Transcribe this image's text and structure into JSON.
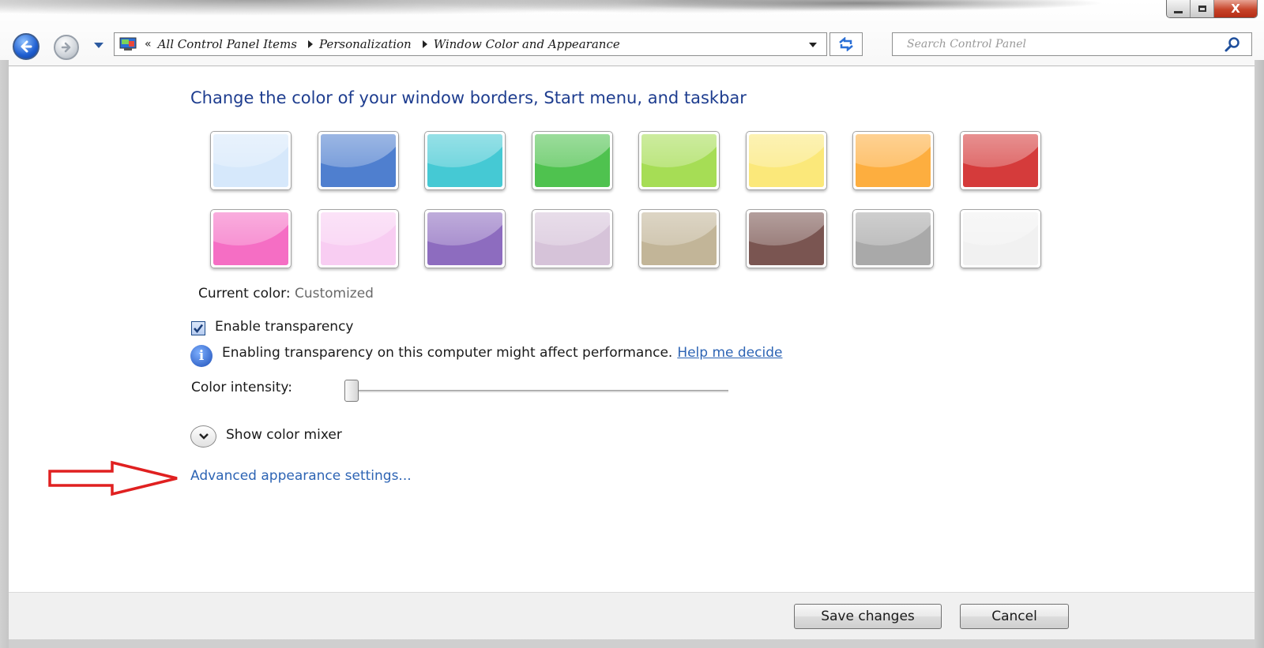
{
  "window": {
    "caption": {
      "minimize": "",
      "maximize": "",
      "close": "X"
    }
  },
  "address_bar": {
    "chevron": "«",
    "items": [
      "All Control Panel Items",
      "Personalization",
      "Window Color and Appearance"
    ]
  },
  "search": {
    "placeholder": "Search Control Panel"
  },
  "main": {
    "heading": "Change the color of your window borders, Start menu, and taskbar",
    "swatches": [
      {
        "color": "#d6e8fb"
      },
      {
        "color": "#4f7fcf"
      },
      {
        "color": "#45c9d4"
      },
      {
        "color": "#4fc24f"
      },
      {
        "color": "#a6dd55"
      },
      {
        "color": "#fbe87a"
      },
      {
        "color": "#fdae3f"
      },
      {
        "color": "#d53b3b"
      },
      {
        "color": "#f56ec4"
      },
      {
        "color": "#f8cdf2"
      },
      {
        "color": "#8d6cbf"
      },
      {
        "color": "#d6c3d9"
      },
      {
        "color": "#c2b598"
      },
      {
        "color": "#7a5551"
      },
      {
        "color": "#a9a9a9"
      },
      {
        "color": "#f1f1f1"
      }
    ],
    "current_color_label": "Current color:",
    "current_color_value": "Customized",
    "transparency_label": "Enable transparency",
    "transparency_checked": true,
    "info_icon": "i",
    "info_text": "Enabling transparency on this computer might affect performance.",
    "info_link": "Help me decide",
    "intensity_label": "Color intensity:",
    "intensity_value": 0,
    "mixer_label": "Show color mixer",
    "advanced_link": "Advanced appearance settings..."
  },
  "footer": {
    "save_label": "Save changes",
    "cancel_label": "Cancel"
  },
  "colors": {
    "accent_link": "#2d64b4",
    "heading": "#1e3d8f",
    "annotation_arrow": "#e02020"
  }
}
